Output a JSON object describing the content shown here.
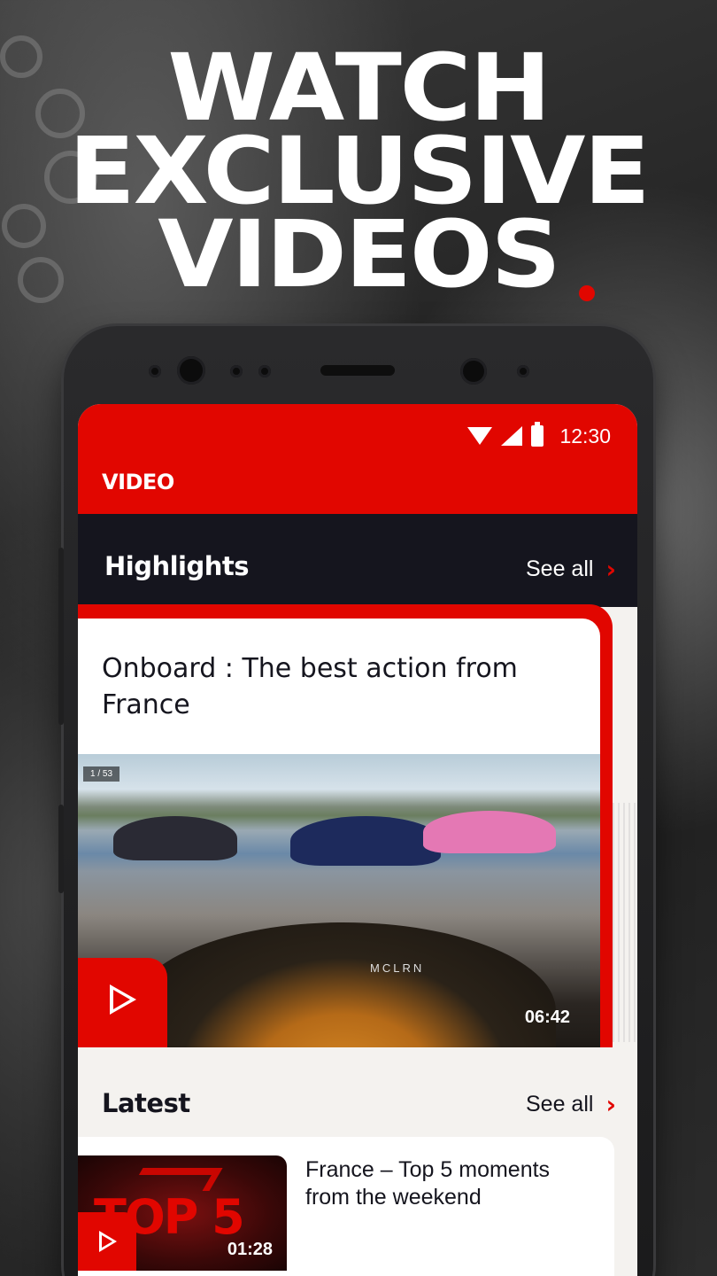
{
  "promo": {
    "line1": "WATCH",
    "line2": "EXCLUSIVE",
    "line3": "VIDEOS"
  },
  "status_bar": {
    "time": "12:30",
    "icons": [
      "wifi-icon",
      "signal-icon",
      "battery-icon"
    ]
  },
  "app_bar": {
    "title": "VIDEO"
  },
  "highlights": {
    "title": "Highlights",
    "see_all": "See all",
    "card": {
      "title": "Onboard : The best action from France",
      "counter": "1 / 53",
      "overlay_text": "MCLRN",
      "duration": "06:42"
    }
  },
  "latest": {
    "title": "Latest",
    "see_all": "See all",
    "items": [
      {
        "title": "France – Top 5 moments from the weekend",
        "thumb_text": "TOP 5",
        "duration": "01:28"
      }
    ]
  },
  "colors": {
    "brand_red": "#e10600",
    "dark": "#15151e",
    "background": "#f4f2ef"
  }
}
